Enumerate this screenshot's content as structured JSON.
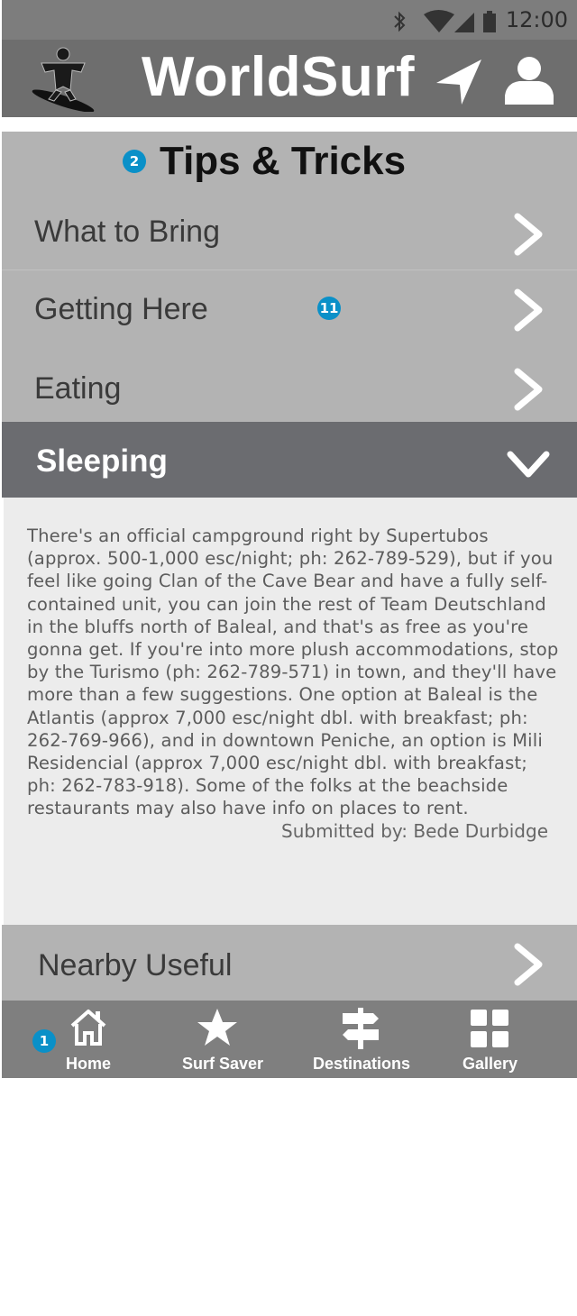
{
  "status": {
    "time": "12:00"
  },
  "header": {
    "title": "WorldSurf"
  },
  "tips": {
    "title": "Tips & Tricks",
    "title_badge": "2",
    "items": [
      {
        "label": "What to Bring"
      },
      {
        "label": "Getting Here",
        "badge": "11"
      },
      {
        "label": "Eating"
      }
    ]
  },
  "expanded": {
    "label": "Sleeping",
    "body": "There's an official campground right by Supertubos (approx. 500-1,000 esc/night; ph: 262-789-529), but if you feel like going Clan of the Cave Bear and have a fully self-contained unit, you can join the rest of Team Deutschland in the bluffs north of Baleal, and that's as free as you're gonna get. If you're into more plush accommodations, stop by the Turismo (ph: 262-789-571) in town, and they'll have more than a few suggestions. One option at Baleal is the Atlantis (approx 7,000 esc/night dbl. with breakfast; ph: 262-769-966), and in downtown Peniche, an option is Mili Residencial (approx 7,000 esc/night dbl. with breakfast; ph: 262-783-918). Some of the folks at the beachside restaurants may also have info on places to rent.",
    "submitted_by": "Submitted by:  Bede Durbidge"
  },
  "nearby": {
    "label": "Nearby Useful"
  },
  "tabbar": {
    "home_badge": "1",
    "tabs": [
      {
        "label": "Home",
        "icon": "home-icon"
      },
      {
        "label": "Surf Saver",
        "icon": "star-icon"
      },
      {
        "label": "Destinations",
        "icon": "signpost-icon"
      },
      {
        "label": "Gallery",
        "icon": "grid-icon"
      }
    ]
  },
  "colors": {
    "header_bg": "#6e6e6e",
    "list_bg": "#b3b3b3",
    "expanded_bg": "#6b6c70",
    "content_bg": "#ececec",
    "badge": "#0a90c8"
  }
}
